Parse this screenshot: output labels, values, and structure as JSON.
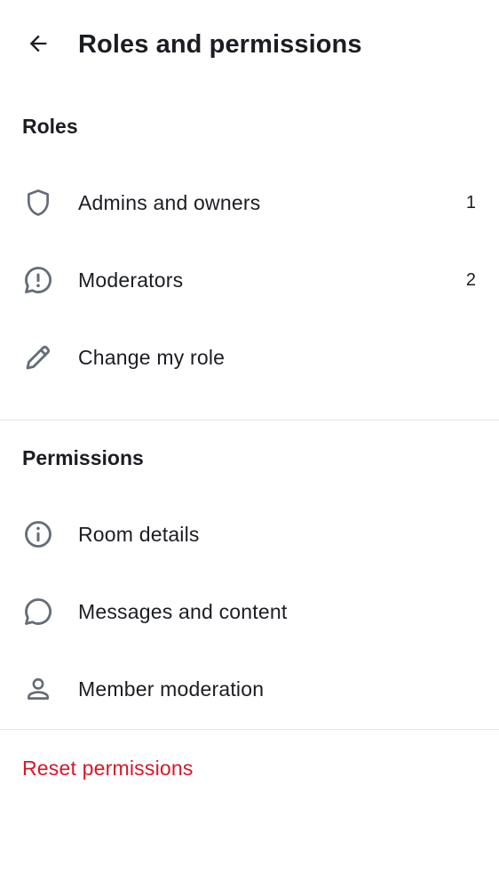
{
  "header": {
    "title": "Roles and permissions",
    "back_icon": "arrow-left-icon"
  },
  "roles_section": {
    "title": "Roles",
    "items": [
      {
        "label": "Admins and owners",
        "count": "1",
        "icon": "shield-icon"
      },
      {
        "label": "Moderators",
        "count": "2",
        "icon": "chat-alert-icon"
      },
      {
        "label": "Change my role",
        "count": "",
        "icon": "pencil-icon"
      }
    ]
  },
  "permissions_section": {
    "title": "Permissions",
    "items": [
      {
        "label": "Room details",
        "icon": "info-icon"
      },
      {
        "label": "Messages and content",
        "icon": "chat-bubble-icon"
      },
      {
        "label": "Member moderation",
        "icon": "user-icon"
      }
    ]
  },
  "reset": {
    "label": "Reset permissions",
    "color": "#d51928"
  },
  "colors": {
    "text": "#1b1d22",
    "icon": "#656d77",
    "divider": "#e3e5e8",
    "danger": "#d51928"
  }
}
